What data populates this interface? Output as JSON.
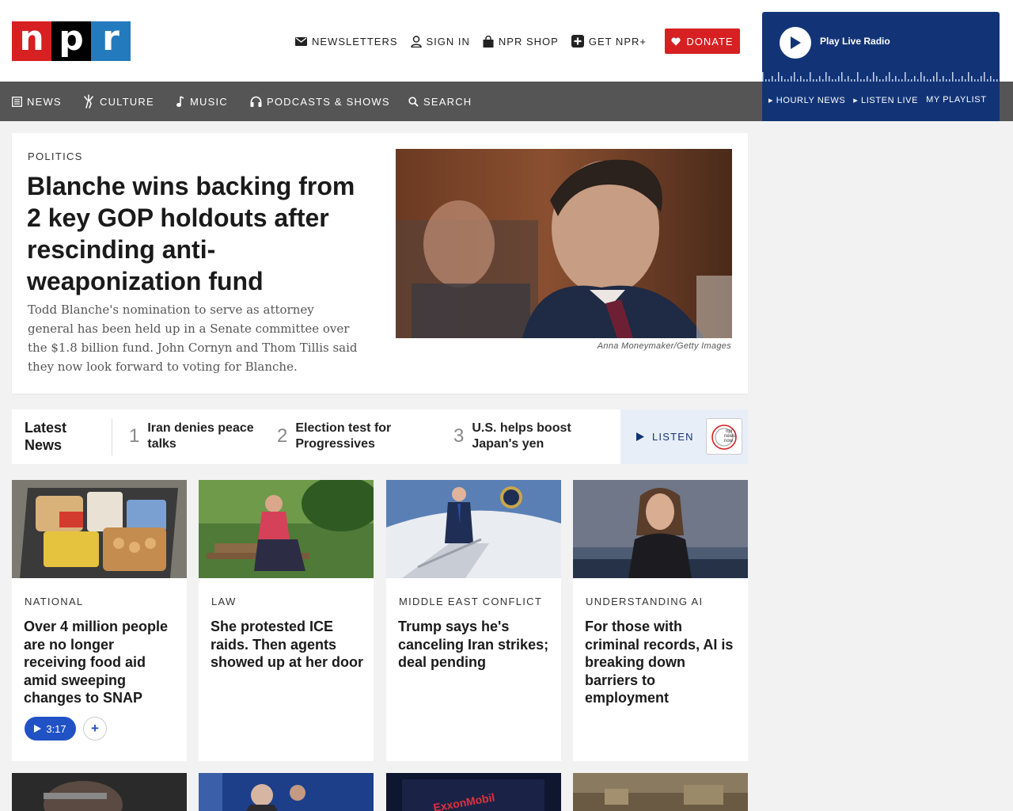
{
  "header": {
    "logo": {
      "letters": [
        "n",
        "p",
        "r"
      ],
      "colors": [
        "#d62021",
        "#000000",
        "#237bbd"
      ]
    },
    "utility": [
      {
        "label": "NEWSLETTERS",
        "icon": "mail-icon"
      },
      {
        "label": "SIGN IN",
        "icon": "user-icon"
      },
      {
        "label": "NPR SHOP",
        "icon": "shopping-bag-icon"
      },
      {
        "label": "GET NPR+",
        "icon": "plus-square-icon"
      }
    ],
    "donate": {
      "label": "DONATE",
      "icon": "heart-icon",
      "color": "#d62021"
    }
  },
  "nav": [
    {
      "label": "NEWS",
      "icon": "newspaper-icon"
    },
    {
      "label": "CULTURE",
      "icon": "culture-icon"
    },
    {
      "label": "MUSIC",
      "icon": "music-note-icon"
    },
    {
      "label": "PODCASTS & SHOWS",
      "icon": "headphones-icon"
    },
    {
      "label": "SEARCH",
      "icon": "search-icon"
    }
  ],
  "player": {
    "play_label": "Play Live Radio",
    "links": [
      "▸ HOURLY NEWS",
      "▸ LISTEN LIVE",
      "MY PLAYLIST"
    ],
    "color": "#123477"
  },
  "hero": {
    "kicker": "POLITICS",
    "title": "Blanche wins backing from 2 key GOP holdouts after rescinding anti-weaponization fund",
    "teaser": "Todd Blanche's nomination to serve as attorney general has been held up in a Senate committee over the $1.8 billion fund. John Cornyn and Thom Tillis said they now look forward to voting for Blanche.",
    "credit": "Anna Moneymaker/Getty Images"
  },
  "latest": {
    "title": "Latest News",
    "items": [
      {
        "num": "1",
        "text": "Iran denies peace talks"
      },
      {
        "num": "2",
        "text": "Election test for Progressives"
      },
      {
        "num": "3",
        "text": "U.S. helps boost Japan's yen"
      }
    ],
    "listen_label": "LISTEN",
    "logo_text": "npr news now"
  },
  "cards": [
    {
      "kicker": "NATIONAL",
      "title": "Over 4 million people are no longer receiving food aid amid sweeping changes to SNAP",
      "audio": "3:17"
    },
    {
      "kicker": "LAW",
      "title": "She protested ICE raids. Then agents showed up at her door"
    },
    {
      "kicker": "MIDDLE EAST CONFLICT",
      "title": "Trump says he's canceling Iran strikes; deal pending"
    },
    {
      "kicker": "UNDERSTANDING AI",
      "title": "For those with criminal records, AI is breaking down barriers to employment"
    }
  ],
  "bottom_card_logo": "ExxonMobil"
}
